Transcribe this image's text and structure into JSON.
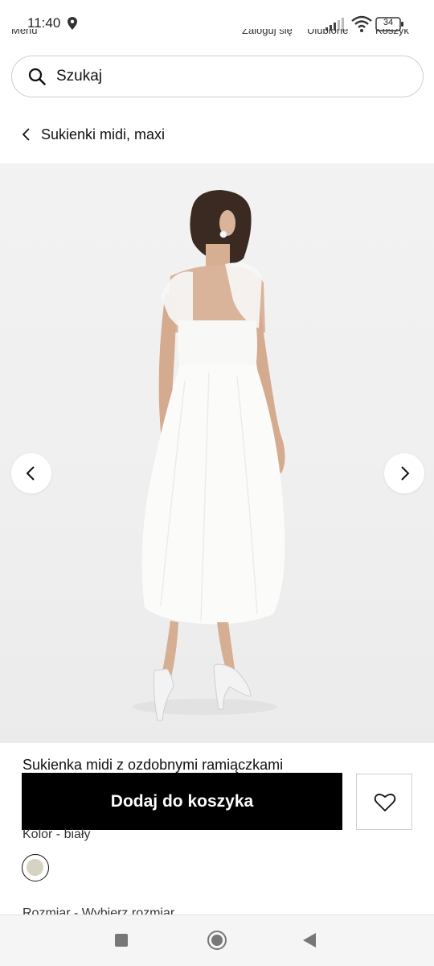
{
  "status_bar": {
    "time": "11:40",
    "battery": "34",
    "icons": [
      "location-icon",
      "signal-icon",
      "wifi-icon",
      "battery-icon"
    ]
  },
  "top_nav": {
    "menu": "Menu",
    "login": "Zaloguj się",
    "favorites": "Ulubione",
    "cart": "Koszyk"
  },
  "search": {
    "placeholder": "Szukaj"
  },
  "breadcrumb": {
    "label": "Sukienki midi, maxi"
  },
  "product": {
    "title": "Sukienka midi z ozdobnymi ramiączkami",
    "add_to_cart_label": "Dodaj do koszyka",
    "color_label": "Kolor - biały",
    "color_swatch_hex": "#d6d2c4",
    "size_label": "Rozmiar - Wybierz rozmiar"
  },
  "colors": {
    "primary_button_bg": "#000000",
    "primary_button_text": "#ffffff",
    "image_bg": "#efefef"
  }
}
